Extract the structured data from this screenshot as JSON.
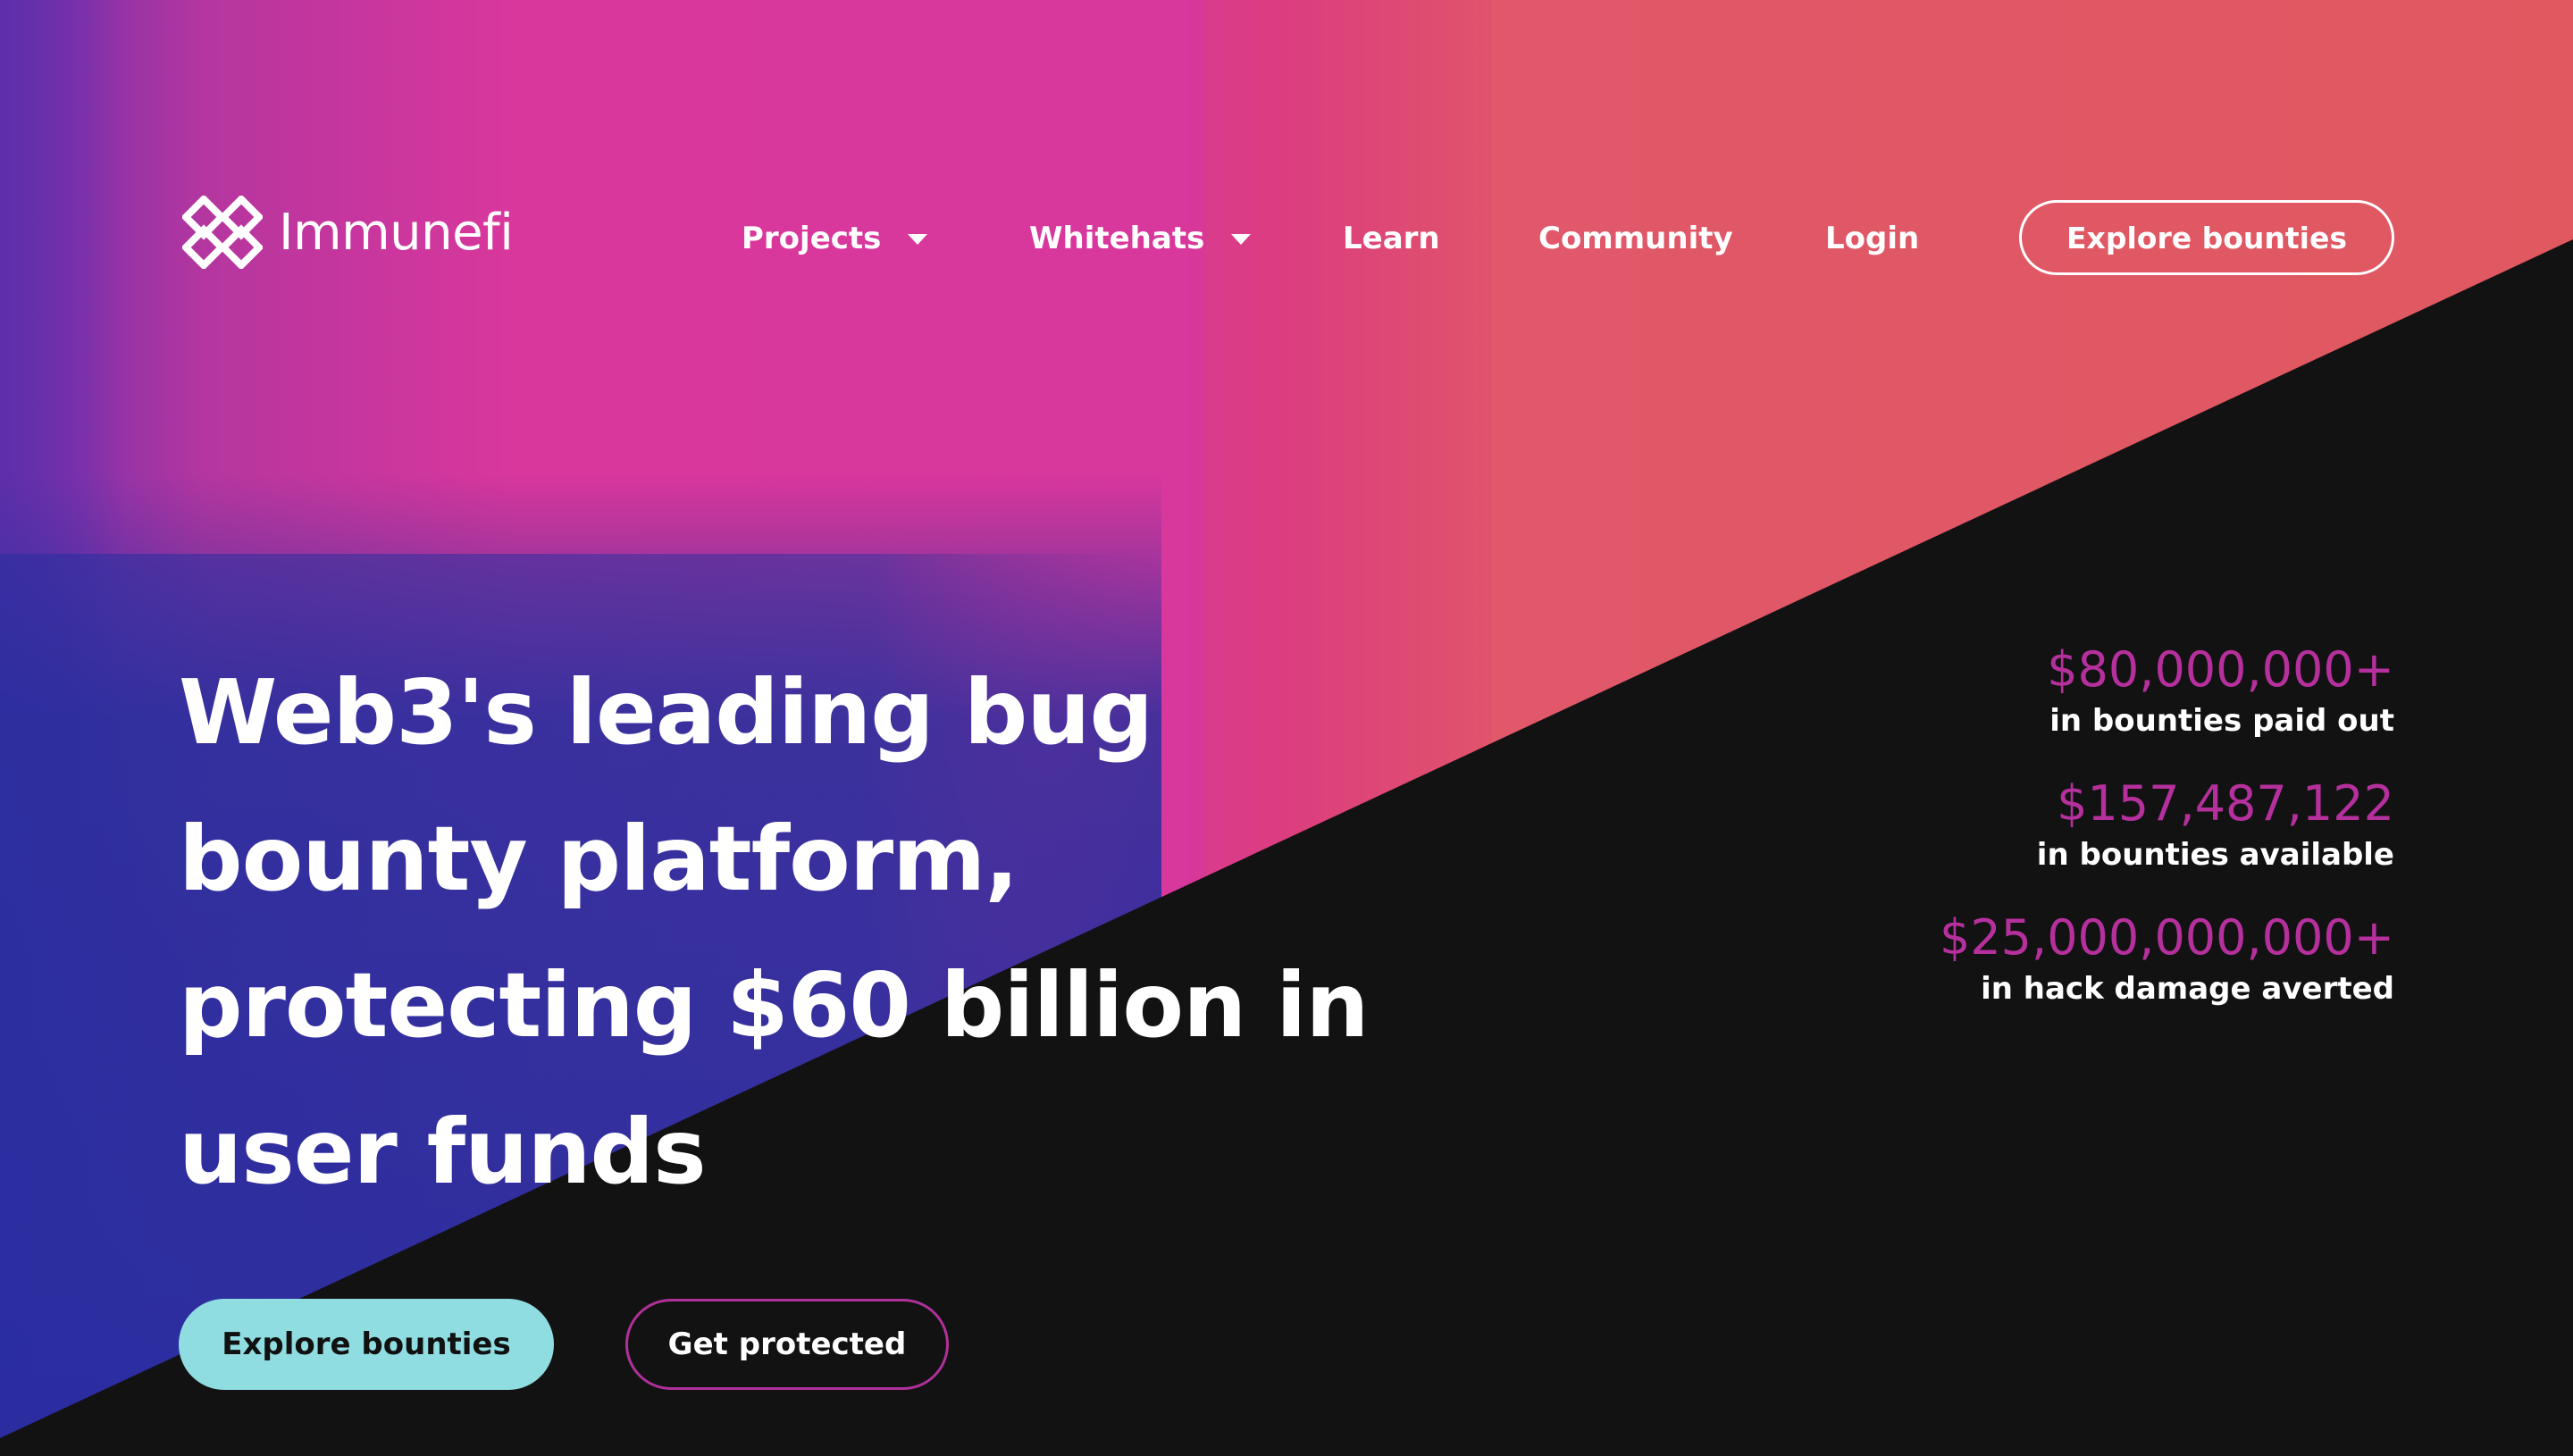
{
  "brand": {
    "name": "Immunefi",
    "logo_icon": "immunefi-logo-icon"
  },
  "nav": {
    "items": [
      {
        "label": "Projects",
        "has_dropdown": true
      },
      {
        "label": "Whitehats",
        "has_dropdown": true
      },
      {
        "label": "Learn",
        "has_dropdown": false
      },
      {
        "label": "Community",
        "has_dropdown": false
      },
      {
        "label": "Login",
        "has_dropdown": false
      }
    ],
    "cta_label": "Explore bounties"
  },
  "hero": {
    "headline": "Web3's leading bug bounty platform, protecting $60 billion in user funds",
    "primary_button": "Explore bounties",
    "secondary_button": "Get protected"
  },
  "stats": [
    {
      "value": "$80,000,000+",
      "label": "in bounties paid out"
    },
    {
      "value": "$157,487,122",
      "label": "in bounties available"
    },
    {
      "value": "$25,000,000,000+",
      "label": "in hack damage averted"
    }
  ],
  "colors": {
    "accent_purple": "#b6309d",
    "primary_button_bg": "#8fdde1",
    "dark_bg": "#121212",
    "gradient_pink": "#d9379c",
    "gradient_coral": "#e15866",
    "gradient_blue": "#2a2ea0"
  }
}
